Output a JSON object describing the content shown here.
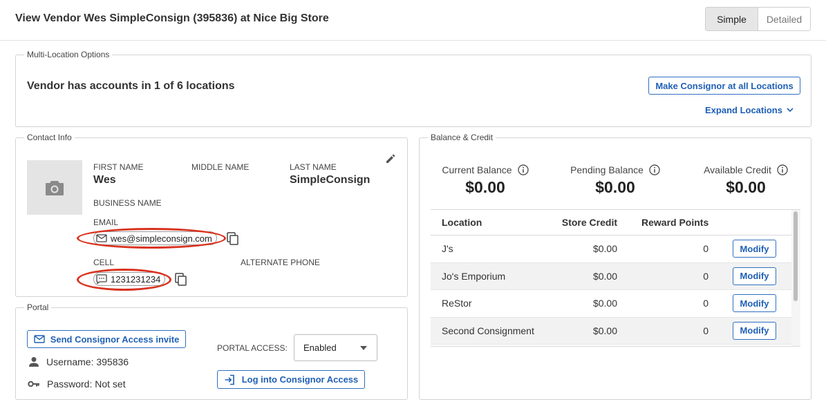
{
  "header": {
    "title": "View Vendor Wes SimpleConsign (395836) at Nice Big Store",
    "view_options": [
      "Simple",
      "Detailed"
    ]
  },
  "multi_location": {
    "legend": "Multi-Location Options",
    "summary": "Vendor has accounts in 1 of 6 locations",
    "make_consignor_button": "Make Consignor at all Locations",
    "expand_link": "Expand Locations"
  },
  "contact": {
    "legend": "Contact Info",
    "first_name_label": "FIRST NAME",
    "first_name": "Wes",
    "middle_name_label": "MIDDLE NAME",
    "middle_name": "",
    "last_name_label": "LAST NAME",
    "last_name": "SimpleConsign",
    "business_name_label": "BUSINESS NAME",
    "email_label": "EMAIL",
    "email": "wes@simpleconsign.com",
    "cell_label": "CELL",
    "cell": "1231231234",
    "alt_phone_label": "ALTERNATE PHONE",
    "icons": {
      "photo": "camera-icon",
      "edit": "pencil-icon",
      "email": "envelope-icon",
      "cell": "message-icon",
      "copy": "copy-icon"
    }
  },
  "portal": {
    "legend": "Portal",
    "send_invite_button": "Send Consignor Access invite",
    "username": "Username: 395836",
    "password": "Password: Not set",
    "portal_access_label": "PORTAL ACCESS:",
    "portal_access_value": "Enabled",
    "login_button": "Log into Consignor Access"
  },
  "balance": {
    "legend": "Balance & Credit",
    "summary": [
      {
        "label": "Current Balance",
        "value": "$0.00"
      },
      {
        "label": "Pending Balance",
        "value": "$0.00"
      },
      {
        "label": "Available Credit",
        "value": "$0.00"
      }
    ],
    "columns": [
      "Location",
      "Store Credit",
      "Reward Points"
    ],
    "rows": [
      {
        "location": "J's",
        "store_credit": "$0.00",
        "reward_points": "0",
        "action": "Modify"
      },
      {
        "location": "Jo's Emporium",
        "store_credit": "$0.00",
        "reward_points": "0",
        "action": "Modify"
      },
      {
        "location": "ReStor",
        "store_credit": "$0.00",
        "reward_points": "0",
        "action": "Modify"
      },
      {
        "location": "Second Consignment",
        "store_credit": "$0.00",
        "reward_points": "0",
        "action": "Modify"
      }
    ]
  },
  "colors": {
    "accent": "#1f5fb5",
    "highlight_oval": "#d9321f",
    "border": "#d3d3d3"
  }
}
